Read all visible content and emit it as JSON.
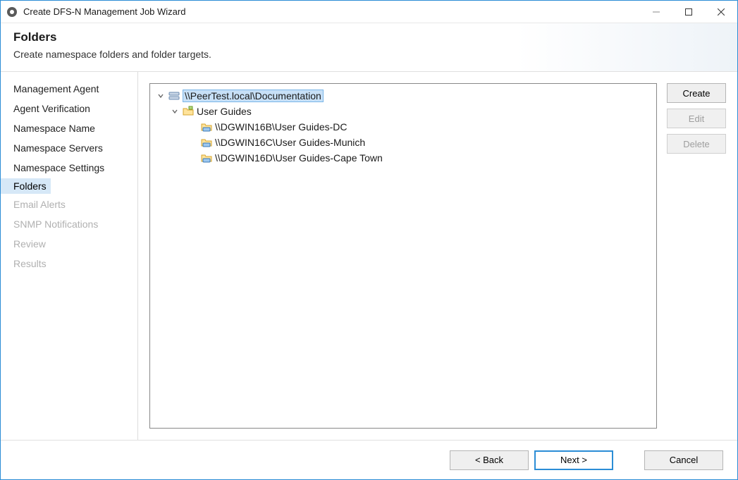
{
  "window": {
    "title": "Create DFS-N Management Job Wizard"
  },
  "banner": {
    "title": "Folders",
    "subtitle": "Create namespace folders and folder targets."
  },
  "steps": [
    {
      "label": "Management Agent",
      "state": "done"
    },
    {
      "label": "Agent Verification",
      "state": "done"
    },
    {
      "label": "Namespace Name",
      "state": "done"
    },
    {
      "label": "Namespace Servers",
      "state": "done"
    },
    {
      "label": "Namespace Settings",
      "state": "done"
    },
    {
      "label": "Folders",
      "state": "active"
    },
    {
      "label": "Email Alerts",
      "state": "disabled"
    },
    {
      "label": "SNMP Notifications",
      "state": "disabled"
    },
    {
      "label": "Review",
      "state": "disabled"
    },
    {
      "label": "Results",
      "state": "disabled"
    }
  ],
  "tree": {
    "root": {
      "label": "\\\\PeerTest.local\\Documentation",
      "selected": true,
      "children": [
        {
          "label": "User Guides",
          "targets": [
            {
              "label": "\\\\DGWIN16B\\User Guides-DC"
            },
            {
              "label": "\\\\DGWIN16C\\User Guides-Munich"
            },
            {
              "label": "\\\\DGWIN16D\\User Guides-Cape Town"
            }
          ]
        }
      ]
    }
  },
  "actions": {
    "create": "Create",
    "edit": "Edit",
    "delete": "Delete"
  },
  "footer": {
    "back": "< Back",
    "next": "Next >",
    "cancel": "Cancel"
  }
}
